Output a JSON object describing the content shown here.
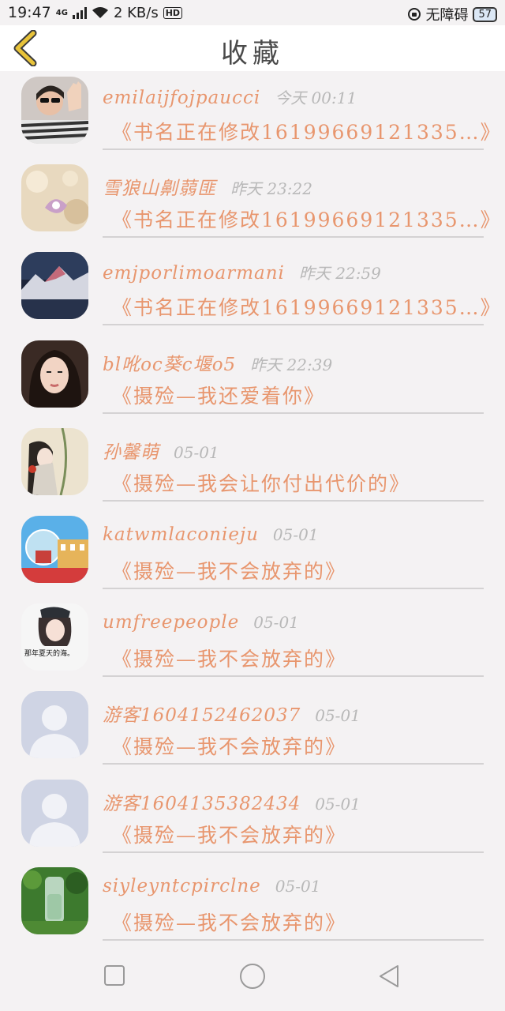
{
  "status_bar": {
    "time": "19:47",
    "network_label": "4G",
    "speed": "2 KB/s",
    "hd_badge": "HD",
    "accessibility_label": "无障碍",
    "battery": "57"
  },
  "header": {
    "title": "收藏"
  },
  "favorites": [
    {
      "username": "emilaijfojpaucci",
      "time": "今天  00:11",
      "book": "《书名正在修改16199669121335…》"
    },
    {
      "username": "雪狼山劓蒻匪",
      "time": "昨天  23:22",
      "book": "《书名正在修改16199669121335…》"
    },
    {
      "username": "emjporlimoarmani",
      "time": "昨天  22:59",
      "book": "《书名正在修改16199669121335…》"
    },
    {
      "username": "bl吪oc葵c堰o5",
      "time": "昨天  22:39",
      "book": "《摄殓—我还爱着你》"
    },
    {
      "username": "孙馨萌",
      "time": "05-01",
      "book": "《摄殓—我会让你付出代价的》"
    },
    {
      "username": "katwmlaconieju",
      "time": "05-01",
      "book": "《摄殓—我不会放弃的》"
    },
    {
      "username": "umfreepeople",
      "time": "05-01",
      "book": "《摄殓—我不会放弃的》"
    },
    {
      "username": "游客1604152462037",
      "time": "05-01",
      "book": "《摄殓—我不会放弃的》"
    },
    {
      "username": "游客1604135382434",
      "time": "05-01",
      "book": "《摄殓—我不会放弃的》"
    },
    {
      "username": "siyleyntcpirclne",
      "time": "05-01",
      "book": "《摄殓—我不会放弃的》"
    }
  ],
  "avatar_caption": "那年夏天的海。",
  "colors": {
    "accent": "#e8966e",
    "muted": "#b8b8b8",
    "back_arrow": "#e8c33a",
    "background": "#f4f2f3"
  },
  "icons": {
    "back": "chevron-left-icon",
    "nav": [
      "square-icon",
      "circle-icon",
      "triangle-back-icon"
    ]
  }
}
